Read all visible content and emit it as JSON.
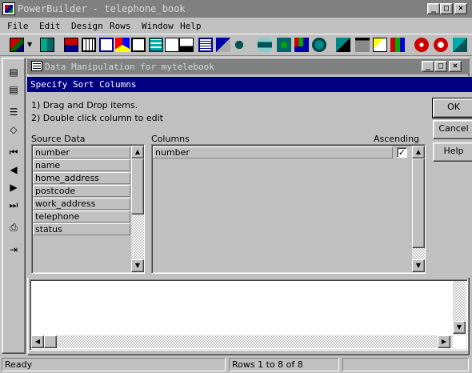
{
  "app": {
    "title": "PowerBuilder - telephone_book"
  },
  "window_controls": {
    "minimize": "_",
    "maximize": "□",
    "close": "×"
  },
  "menu": {
    "items": [
      "File",
      "Edit",
      "Design",
      "Rows",
      "Window",
      "Help"
    ]
  },
  "toolbar": {
    "icons": [
      "datawindow-icon",
      "dropdown-arrow-icon",
      "preview-icon",
      "select-icon",
      "grid-icon",
      "shapes-icon",
      "columns-icon",
      "compute-icon",
      "table-icon",
      "export-icon",
      "report-icon",
      "graph-icon",
      "groups-icon",
      "database-icon",
      "joins-icon",
      "chart-icon",
      "objects-icon",
      "query-icon",
      "library-icon",
      "edit-icon",
      "palette-icon",
      "debug-icon",
      "stop-icon",
      "exit-icon"
    ]
  },
  "side_toolbar": {
    "icons": [
      "insert-row-icon",
      "delete-row-icon",
      "sort-icon",
      "erase-icon",
      "first-icon",
      "prior-icon",
      "next-icon",
      "last-icon",
      "print-icon",
      "close-icon"
    ]
  },
  "child_window": {
    "title": "Data Manipulation for mytelebook"
  },
  "dialog": {
    "title": "Specify Sort Columns",
    "instructions": [
      "1) Drag and Drop items.",
      "2) Double click column to edit"
    ],
    "source_label": "Source Data",
    "columns_label": "Columns",
    "ascending_label": "Ascending",
    "source_items": [
      "number",
      "name",
      "home_address",
      "postcode",
      "work_address",
      "telephone",
      "status"
    ],
    "column_items": [
      {
        "name": "number",
        "ascending": true
      }
    ],
    "buttons": {
      "ok": "OK",
      "cancel": "Cancel",
      "help": "Help"
    }
  },
  "status": {
    "left": "Ready",
    "middle": "Rows 1 to 8 of 8"
  }
}
